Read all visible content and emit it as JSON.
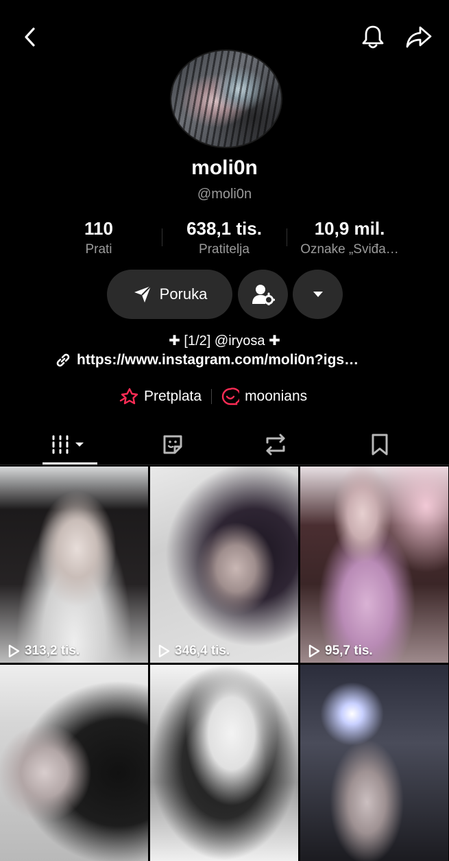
{
  "header": {
    "back_icon": "chevron-left-icon",
    "bell_icon": "bell-icon",
    "share_icon": "share-arrow-icon"
  },
  "profile": {
    "display_name": "moli0n",
    "username": "@moli0n"
  },
  "stats": [
    {
      "value": "110",
      "label": "Prati"
    },
    {
      "value": "638,1 tis.",
      "label": "Pratitelja"
    },
    {
      "value": "10,9 mil.",
      "label": "Oznake „Sviđa…"
    }
  ],
  "actions": {
    "message_label": "Poruka",
    "message_icon": "send-icon",
    "friend_icon": "user-settings-icon",
    "more_icon": "caret-down-icon"
  },
  "bio": {
    "line1": "✚ [1/2] @iryosa ✚",
    "link": "https://www.instagram.com/moli0n?igs…",
    "link_icon": "link-icon"
  },
  "subscriptions": {
    "subscribe_label": "Pretplata",
    "community_label": "moonians"
  },
  "tabs": [
    {
      "name": "videos",
      "icon": "grid-icon",
      "active": true
    },
    {
      "name": "favorites",
      "icon": "sticker-icon",
      "active": false
    },
    {
      "name": "reposts",
      "icon": "repost-icon",
      "active": false
    },
    {
      "name": "saved",
      "icon": "bookmark-icon",
      "active": false
    }
  ],
  "videos": [
    {
      "views": "313,2 tis."
    },
    {
      "views": "346,4 tis."
    },
    {
      "views": "95,7 tis."
    },
    {
      "views": ""
    },
    {
      "views": ""
    },
    {
      "views": ""
    }
  ],
  "colors": {
    "background": "#000000",
    "button_bg": "#2b2b2b",
    "muted_text": "#9a9a9a",
    "accent_red": "#fe2c55"
  }
}
